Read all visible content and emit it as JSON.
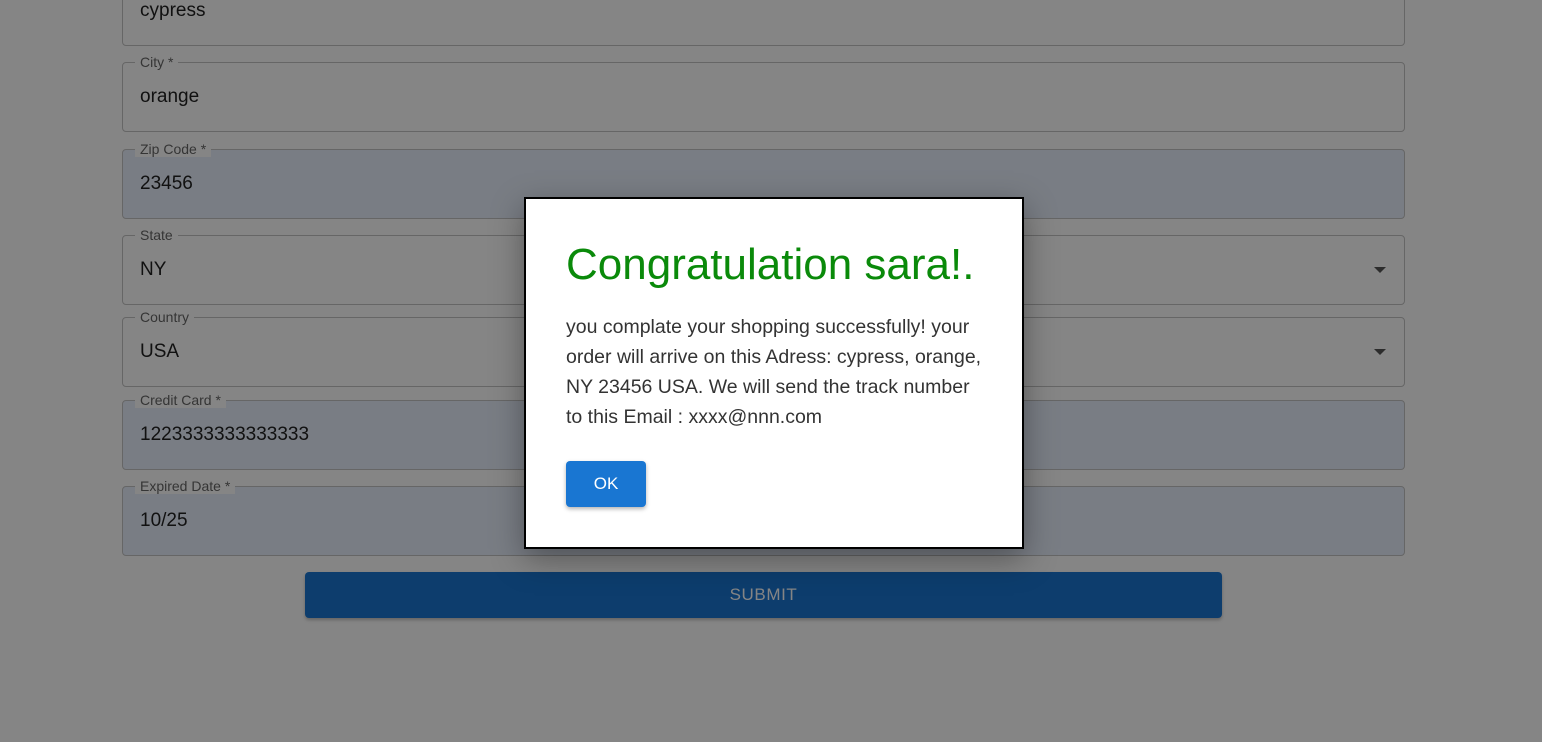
{
  "form": {
    "address_value": "cypress",
    "city": {
      "label": "City *",
      "value": "orange"
    },
    "zip": {
      "label": "Zip Code *",
      "value": "23456"
    },
    "state": {
      "label": "State",
      "value": "NY"
    },
    "country": {
      "label": "Country",
      "value": "USA"
    },
    "credit_card": {
      "label": "Credit Card  *",
      "value": "1223333333333333"
    },
    "expired_date": {
      "label": "Expired Date *",
      "value": "10/25"
    },
    "submit_label": "SUBMIT"
  },
  "dialog": {
    "title": "Congratulation sara!.",
    "message": "you complate your shopping successfully! your order will arrive on this Adress: cypress, orange, NY 23456 USA. We will send the track number to this Email : xxxx@nnn.com",
    "ok_label": "OK"
  },
  "colors": {
    "primary": "#1976d2",
    "title_green": "#0a8a0a",
    "overlay": "rgba(0,0,0,0.48)"
  }
}
